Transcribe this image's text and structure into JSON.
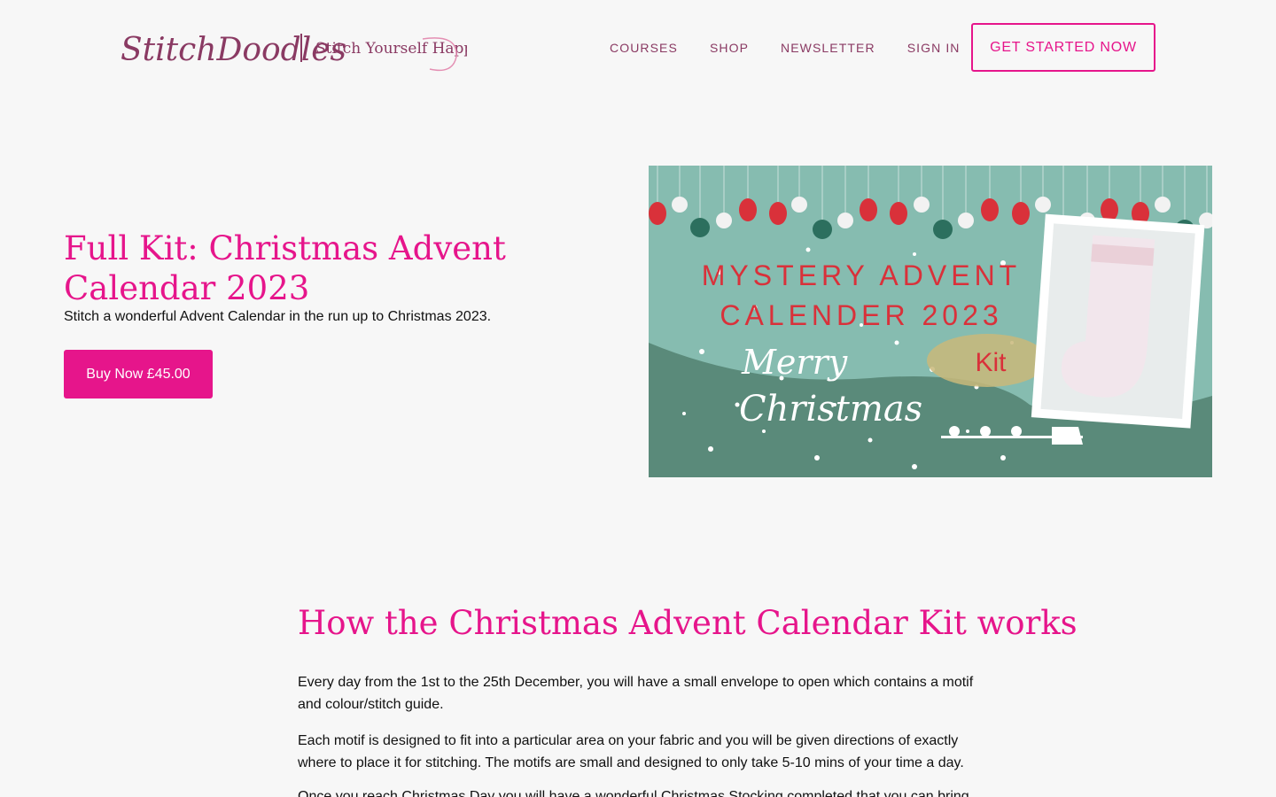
{
  "header": {
    "logo_text": "StitchDoodles",
    "tagline": "Stitch Yourself Happy",
    "nav": [
      {
        "label": "COURSES"
      },
      {
        "label": "SHOP"
      },
      {
        "label": "NEWSLETTER"
      },
      {
        "label": "SIGN IN"
      }
    ],
    "cta_label": "GET STARTED NOW"
  },
  "hero": {
    "title": "Full Kit: Christmas Advent Calendar 2023",
    "subtitle": "Stitch a wonderful Advent Calendar in the run up to Christmas 2023.",
    "buy_label": "Buy Now £45.00",
    "image": {
      "line1": "MYSTERY ADVENT",
      "line2": "CALENDER 2023",
      "script1": "Merry",
      "script2": "Christmas",
      "badge": "Kit"
    }
  },
  "section": {
    "title": "How the Christmas Advent Calendar Kit works",
    "paragraphs": [
      "Every day from the 1st to the 25th December, you will have a small envelope to open which contains a motif and colour/stitch guide.",
      "Each motif is designed to fit into a particular area on your fabric and you will be given directions of exactly where to place it for stitching. The motifs are small and designed to only take 5-10 mins of your time a day.",
      "Once you reach Christmas Day you will have a wonderful Christmas Stocking completed that you can bring"
    ]
  },
  "colors": {
    "accent": "#e6158b",
    "nav": "#8a3a63",
    "background": "#f7f7f7",
    "image_teal": "#86bcb0",
    "image_dark_teal": "#5a8a7a"
  }
}
